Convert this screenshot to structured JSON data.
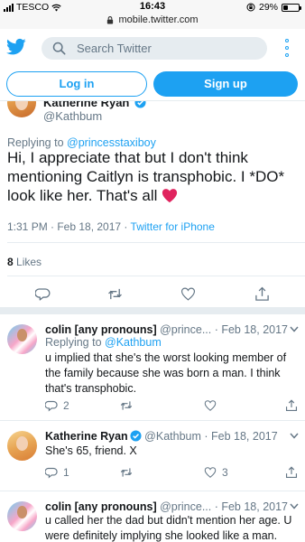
{
  "status_bar": {
    "carrier": "TESCO",
    "time": "16:43",
    "battery": "29%",
    "battery_level": 0.29
  },
  "url_bar": {
    "url": "mobile.twitter.com"
  },
  "header": {
    "search_placeholder": "Search Twitter"
  },
  "auth": {
    "login_label": "Log in",
    "signup_label": "Sign up"
  },
  "main_tweet": {
    "author_name": "Katherine Ryan",
    "author_handle": "@Kathbum",
    "replying_prefix": "Replying to ",
    "replying_to": "@princesstaxiboy",
    "text": "Hi, I appreciate that but I don't think mentioning Caitlyn is transphobic. I *DO* look like her. That's all",
    "timestamp": "1:31 PM · Feb 18, 2017 · ",
    "source": "Twitter for iPhone",
    "likes_count": "8",
    "likes_label": " Likes"
  },
  "replies": [
    {
      "name": "colin [any pronouns]",
      "meta": " @prince... · Feb 18, 2017",
      "replying_prefix": "Replying to ",
      "replying_to": "@Kathbum",
      "text": "u implied that she's the worst looking member of the family because she was born a man. I think that's transphobic.",
      "reply_count": "2"
    },
    {
      "name": "Katherine Ryan",
      "meta": " @Kathbum · Feb 18, 2017",
      "text": "She's 65, friend. X",
      "reply_count": "1",
      "like_count": "3"
    },
    {
      "name": "colin [any pronouns]",
      "meta": " @prince... · Feb 18, 2017",
      "text": "u called her the dad but didn't mention her age. U were definitely implying she looked like a man."
    }
  ],
  "colors": {
    "accent": "#1da1f2",
    "secondary_text": "#657786",
    "divider": "#e6ecf0"
  }
}
